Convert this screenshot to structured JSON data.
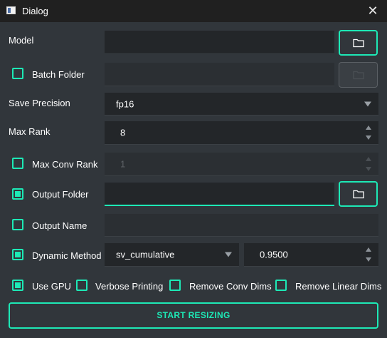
{
  "window": {
    "title": "Dialog",
    "close_glyph": "✕"
  },
  "form": {
    "model": {
      "label": "Model",
      "value": ""
    },
    "batch_folder": {
      "label": "Batch Folder",
      "checked": false,
      "value": ""
    },
    "save_precision": {
      "label": "Save Precision",
      "selected": "fp16"
    },
    "max_rank": {
      "label": "Max Rank",
      "value": "8"
    },
    "max_conv_rank": {
      "label": "Max Conv Rank",
      "checked": false,
      "value": "1"
    },
    "output_folder": {
      "label": "Output Folder",
      "checked": true,
      "value": ""
    },
    "output_name": {
      "label": "Output Name",
      "checked": false,
      "value": ""
    },
    "dynamic_method": {
      "label": "Dynamic Method",
      "checked": true,
      "selected": "sv_cumulative",
      "param_value": "0.9500"
    },
    "options": [
      {
        "label": "Use GPU",
        "checked": true
      },
      {
        "label": "Verbose Printing",
        "checked": false
      },
      {
        "label": "Remove Conv Dims",
        "checked": false
      },
      {
        "label": "Remove Linear Dims",
        "checked": false
      }
    ],
    "start_button": {
      "label": "START RESIZING"
    }
  },
  "colors": {
    "accent": "#1de9b6",
    "background": "#31363b",
    "field": "#232629",
    "titlebar": "#202020"
  },
  "icons": {
    "browse": "folder-icon",
    "dropdown": "chevron-down-icon",
    "spin": "spinner-arrows-icon"
  }
}
